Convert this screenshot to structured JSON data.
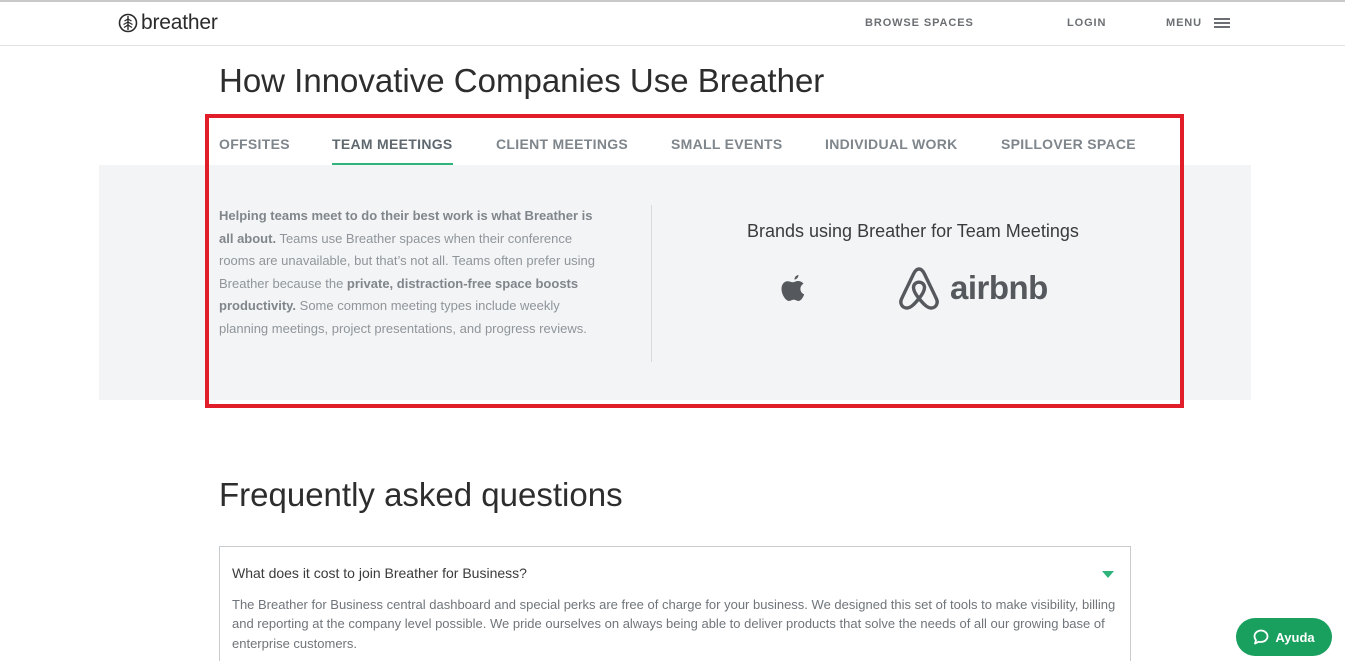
{
  "header": {
    "logo_text": "breather",
    "nav": {
      "browse_spaces": "BROWSE SPACES",
      "login": "LOGIN",
      "menu": "MENU"
    }
  },
  "main": {
    "title": "How Innovative Companies Use Breather",
    "tabs": [
      {
        "label": "OFFSITES",
        "active": false
      },
      {
        "label": "TEAM MEETINGS",
        "active": true
      },
      {
        "label": "CLIENT MEETINGS",
        "active": false
      },
      {
        "label": "SMALL EVENTS",
        "active": false
      },
      {
        "label": "INDIVIDUAL WORK",
        "active": false
      },
      {
        "label": "SPILLOVER SPACE",
        "active": false
      }
    ],
    "panel": {
      "text_bold_1": "Helping teams meet to do their best work is what Breather is all about.",
      "text_1": " Teams use Breather spaces when their conference rooms are unavailable, but that’s not all. Teams often prefer using Breather because the ",
      "text_bold_2": "private, distraction-free space boosts productivity.",
      "text_2": " Some common meeting types include weekly planning meetings, project presentations, and progress reviews.",
      "brands_title": "Brands using Breather for Team Meetings",
      "brands": [
        {
          "name": "Apple",
          "icon": "apple-logo-icon"
        },
        {
          "name": "airbnb",
          "icon": "airbnb-logo-icon"
        }
      ]
    }
  },
  "faq": {
    "title": "Frequently asked questions",
    "items": [
      {
        "question": "What does it cost to join Breather for Business?",
        "answer": "The Breather for Business central dashboard and special perks are free of charge for your business. We designed this set of tools to make visibility, billing and reporting at the company level possible. We pride ourselves on always being able to deliver products that solve the needs of all our growing base of enterprise customers."
      }
    ]
  },
  "help_button": {
    "label": "Ayuda"
  },
  "colors": {
    "accent_green": "#2fb37a",
    "highlight_red": "#e11d2a",
    "help_button_green": "#19a05e",
    "panel_background": "#f3f4f5"
  }
}
